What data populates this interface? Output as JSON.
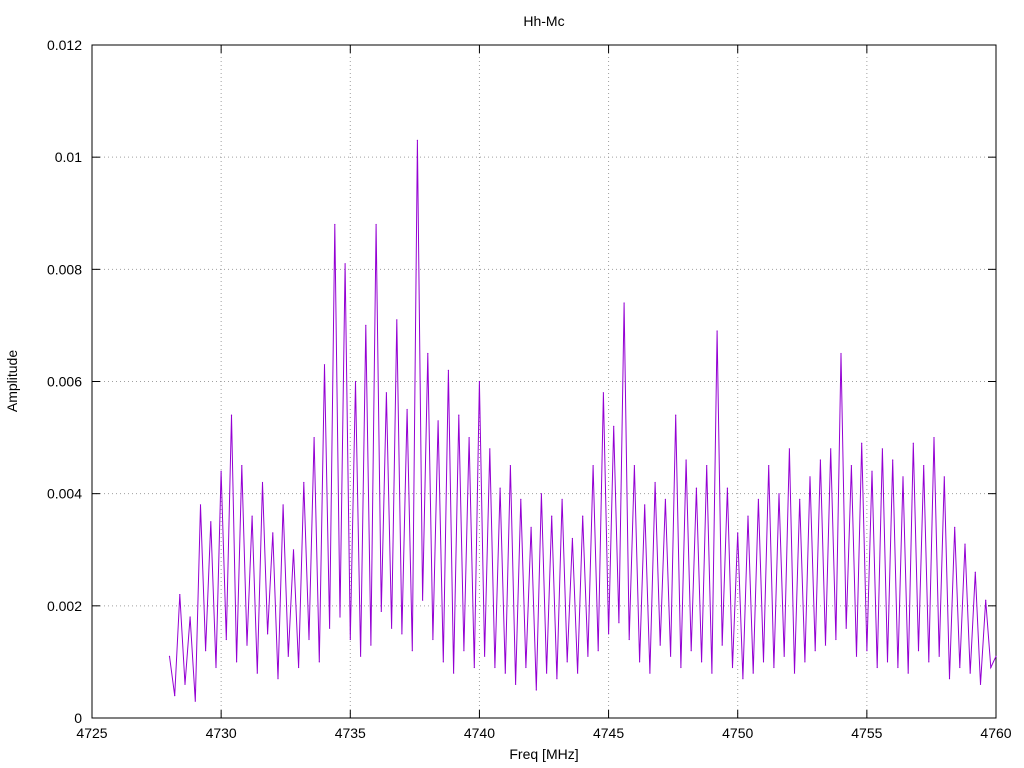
{
  "chart_data": {
    "type": "line",
    "title": "Hh-Mc",
    "xlabel": "Freq [MHz]",
    "ylabel": "Amplitude",
    "xlim": [
      4725,
      4760
    ],
    "ylim": [
      0,
      0.012
    ],
    "grid": true,
    "legend": "none",
    "x_ticks": [
      "4725",
      "4730",
      "4735",
      "4740",
      "4745",
      "4750",
      "4755",
      "4760"
    ],
    "y_ticks": [
      "0",
      "0.002",
      "0.004",
      "0.006",
      "0.008",
      "0.01",
      "0.012"
    ],
    "series": [
      {
        "color": "#9400d3",
        "x": [
          4728.0,
          4728.2,
          4728.4,
          4728.6,
          4728.8,
          4729.0,
          4729.2,
          4729.4,
          4729.6,
          4729.8,
          4730.0,
          4730.2,
          4730.4,
          4730.6,
          4730.8,
          4731.0,
          4731.2,
          4731.4,
          4731.6,
          4731.8,
          4732.0,
          4732.2,
          4732.4,
          4732.6,
          4732.8,
          4733.0,
          4733.2,
          4733.4,
          4733.6,
          4733.8,
          4734.0,
          4734.2,
          4734.4,
          4734.6,
          4734.8,
          4735.0,
          4735.2,
          4735.4,
          4735.6,
          4735.8,
          4736.0,
          4736.2,
          4736.4,
          4736.6,
          4736.8,
          4737.0,
          4737.2,
          4737.4,
          4737.6,
          4737.8,
          4738.0,
          4738.2,
          4738.4,
          4738.6,
          4738.8,
          4739.0,
          4739.2,
          4739.4,
          4739.6,
          4739.8,
          4740.0,
          4740.2,
          4740.4,
          4740.6,
          4740.8,
          4741.0,
          4741.2,
          4741.4,
          4741.6,
          4741.8,
          4742.0,
          4742.2,
          4742.4,
          4742.6,
          4742.8,
          4743.0,
          4743.2,
          4743.4,
          4743.6,
          4743.8,
          4744.0,
          4744.2,
          4744.4,
          4744.6,
          4744.8,
          4745.0,
          4745.2,
          4745.4,
          4745.6,
          4745.8,
          4746.0,
          4746.2,
          4746.4,
          4746.6,
          4746.8,
          4747.0,
          4747.2,
          4747.4,
          4747.6,
          4747.8,
          4748.0,
          4748.2,
          4748.4,
          4748.6,
          4748.8,
          4749.0,
          4749.2,
          4749.4,
          4749.6,
          4749.8,
          4750.0,
          4750.2,
          4750.4,
          4750.6,
          4750.8,
          4751.0,
          4751.2,
          4751.4,
          4751.6,
          4751.8,
          4752.0,
          4752.2,
          4752.4,
          4752.6,
          4752.8,
          4753.0,
          4753.2,
          4753.4,
          4753.6,
          4753.8,
          4754.0,
          4754.2,
          4754.4,
          4754.6,
          4754.8,
          4755.0,
          4755.2,
          4755.4,
          4755.6,
          4755.8,
          4756.0,
          4756.2,
          4756.4,
          4756.6,
          4756.8,
          4757.0,
          4757.2,
          4757.4,
          4757.6,
          4757.8,
          4758.0,
          4758.2,
          4758.4,
          4758.6,
          4758.8,
          4759.0,
          4759.2,
          4759.4,
          4759.6,
          4759.8,
          4760.0
        ],
        "y": [
          0.0011,
          0.0004,
          0.0022,
          0.0006,
          0.0018,
          0.0003,
          0.0038,
          0.0012,
          0.0035,
          0.0009,
          0.0044,
          0.0014,
          0.0054,
          0.001,
          0.0045,
          0.0013,
          0.0036,
          0.0008,
          0.0042,
          0.0015,
          0.0033,
          0.0007,
          0.0038,
          0.0011,
          0.003,
          0.0009,
          0.0042,
          0.0014,
          0.005,
          0.001,
          0.0063,
          0.0016,
          0.0088,
          0.0018,
          0.0081,
          0.0014,
          0.006,
          0.0011,
          0.007,
          0.0013,
          0.0088,
          0.0019,
          0.0058,
          0.0016,
          0.0071,
          0.0015,
          0.0055,
          0.0012,
          0.0103,
          0.0021,
          0.0065,
          0.0014,
          0.0053,
          0.001,
          0.0062,
          0.0008,
          0.0054,
          0.0012,
          0.005,
          0.0009,
          0.006,
          0.0011,
          0.0048,
          0.0009,
          0.0041,
          0.0008,
          0.0045,
          0.0006,
          0.0039,
          0.0009,
          0.0034,
          0.0005,
          0.004,
          0.0008,
          0.0036,
          0.0007,
          0.0039,
          0.001,
          0.0032,
          0.0008,
          0.0036,
          0.0011,
          0.0045,
          0.0012,
          0.0058,
          0.0015,
          0.0052,
          0.0017,
          0.0074,
          0.0014,
          0.0045,
          0.001,
          0.0038,
          0.0008,
          0.0042,
          0.0013,
          0.0039,
          0.0011,
          0.0054,
          0.0009,
          0.0046,
          0.0012,
          0.0041,
          0.001,
          0.0045,
          0.0008,
          0.0069,
          0.0013,
          0.0041,
          0.0009,
          0.0033,
          0.0007,
          0.0036,
          0.0008,
          0.0039,
          0.001,
          0.0045,
          0.0009,
          0.004,
          0.0011,
          0.0048,
          0.0008,
          0.0039,
          0.001,
          0.0043,
          0.0012,
          0.0046,
          0.0013,
          0.0048,
          0.0014,
          0.0065,
          0.0016,
          0.0045,
          0.0011,
          0.0049,
          0.0012,
          0.0044,
          0.0009,
          0.0048,
          0.001,
          0.0046,
          0.0009,
          0.0043,
          0.0008,
          0.0049,
          0.0012,
          0.0045,
          0.001,
          0.005,
          0.0011,
          0.0043,
          0.0007,
          0.0034,
          0.0009,
          0.0031,
          0.0008,
          0.0026,
          0.0006,
          0.0021,
          0.0009,
          0.0011
        ]
      }
    ]
  }
}
